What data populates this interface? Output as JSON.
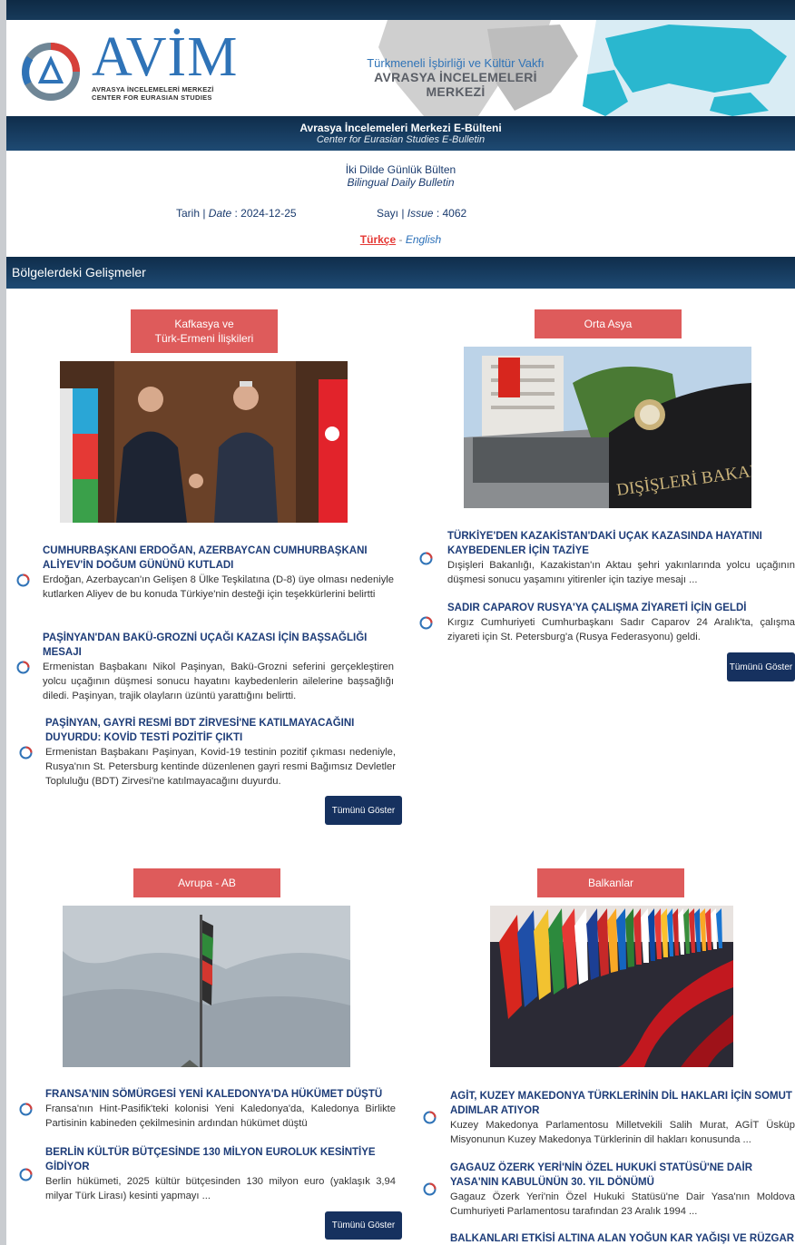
{
  "header": {
    "logo_name": "AVİM",
    "logo_line1": "AVRASYA İNCELEMELERİ MERKEZİ",
    "logo_line2": "CENTER FOR EURASIAN STUDIES",
    "foundation": "Türkmeneli İşbirliği ve Kültür Vakfı",
    "center_name": "AVRASYA İNCELEMELERİ MERKEZİ"
  },
  "bulletin": {
    "title_tr": "Avrasya İncelemeleri Merkezi E-Bülteni",
    "title_en": "Center for Eurasian Studies E-Bulletin",
    "daily_tr": "İki Dilde Günlük Bülten",
    "daily_en": "Bilingual Daily Bulletin",
    "date_label": "Tarih | ",
    "date_label_en": "Date",
    "date_value": " : 2024-12-25",
    "issue_label": "Sayı | ",
    "issue_label_en": "Issue",
    "issue_value": " : 4062",
    "lang_tr": "Türkçe",
    "lang_sep": " - ",
    "lang_en": "English"
  },
  "section_title": "Bölgelerdeki Gelişmeler",
  "categories": {
    "caucasus": {
      "label_l1": "Kafkasya ve",
      "label_l2": "Türk-Ermeni İlişkileri",
      "news": [
        {
          "title": "CUMHURBAŞKANI ERDOĞAN, AZERBAYCAN CUMHURBAŞKANI ALİYEV'İN DOĞUM GÜNÜNÜ KUTLADI",
          "body": "Erdoğan, Azerbaycan'ın Gelişen 8 Ülke Teşkilatına (D-8) üye olması nedeniyle kutlarken Aliyev de bu konuda Türkiye'nin desteği için teşekkürlerini belirtti"
        },
        {
          "title": "PAŞİNYAN'DAN BAKÜ-GROZNİ UÇAĞI KAZASI İÇİN BAŞSAĞLIĞI MESAJI",
          "body": "Ermenistan Başbakanı Nikol Paşinyan, Bakü-Grozni seferini gerçekleştiren yolcu uçağının düşmesi sonucu hayatını kaybedenlerin ailelerine başsağlığı diledi. Paşinyan, trajik olayların üzüntü yarattığını belirtti."
        },
        {
          "title": "PAŞİNYAN, GAYRİ RESMİ BDT ZİRVESİ'NE KATILMAYACAĞINI DUYURDU: KOVİD TESTİ POZİTİF ÇIKTI",
          "body": "Ermenistan Başbakanı Paşinyan, Kovid-19 testinin pozitif çıkması nedeniyle, Rusya'nın St. Petersburg kentinde düzenlenen gayri resmi Bağımsız Devletler Topluluğu (BDT) Zirvesi'ne katılmayacağını duyurdu."
        }
      ],
      "show_all": "Tümünü Göster"
    },
    "central_asia": {
      "label": "Orta Asya",
      "news": [
        {
          "title": "TÜRKİYE'DEN KAZAKİSTAN'DAKİ UÇAK KAZASINDA HAYATINI KAYBEDENLER İÇİN TAZİYE",
          "body": "Dışişleri Bakanlığı, Kazakistan'ın Aktau şehri yakınlarında yolcu uçağının düşmesi sonucu yaşamını yitirenler için taziye mesajı ..."
        },
        {
          "title": "SADIR CAPAROV RUSYA'YA ÇALIŞMA ZİYARETİ İÇİN GELDİ",
          "body": "Kırgız Cumhuriyeti Cumhurbaşkanı Sadır Caparov 24 Aralık'ta, çalışma ziyareti için St. Petersburg'a (Rusya Federasyonu) geldi."
        }
      ],
      "show_all": "Tümünü Göster",
      "photo_text": "DIŞİŞLERİ BAKANLIĞI"
    },
    "europe": {
      "label": "Avrupa - AB",
      "news": [
        {
          "title": "FRANSA'NIN SÖMÜRGESİ YENİ KALEDONYA'DA HÜKÜMET DÜŞTÜ",
          "body": "Fransa'nın Hint-Pasifik'teki kolonisi Yeni Kaledonya'da, Kaledonya Birlikte Partisinin kabineden çekilmesinin ardından hükümet düştü"
        },
        {
          "title": "BERLİN KÜLTÜR BÜTÇESİNDE 130 MİLYON EUROLUK KESİNTİYE GİDİYOR",
          "body": "Berlin hükümeti, 2025 kültür bütçesinden 130 milyon euro (yaklaşık 3,94 milyar Türk Lirası) kesinti yapmayı ..."
        }
      ],
      "show_all": "Tümünü Göster"
    },
    "balkans": {
      "label": "Balkanlar",
      "news": [
        {
          "title": "AGİT, KUZEY MAKEDONYA TÜRKLERİNİN DİL HAKLARI İÇİN SOMUT ADIMLAR ATIYOR",
          "body": "Kuzey Makedonya Parlamentosu Milletvekili Salih Murat, AGİT Üsküp Misyonunun Kuzey Makedonya Türklerinin dil hakları konusunda ..."
        },
        {
          "title": "GAGAUZ ÖZERK YERİ'NİN ÖZEL HUKUKİ STATÜSÜ'NE DAİR YASA'NIN KABULÜNÜN 30. YIL DÖNÜMÜ",
          "body": "Gagauz Özerk Yeri'nin Özel Hukuki Statüsü'ne Dair Yasa'nın Moldova Cumhuriyeti Parlamentosu tarafından 23 Aralık 1994 ..."
        },
        {
          "title": "BALKANLARI ETKİSİ ALTINA ALAN YOĞUN KAR YAĞIŞI VE RÜZGAR",
          "body": ""
        }
      ]
    }
  }
}
